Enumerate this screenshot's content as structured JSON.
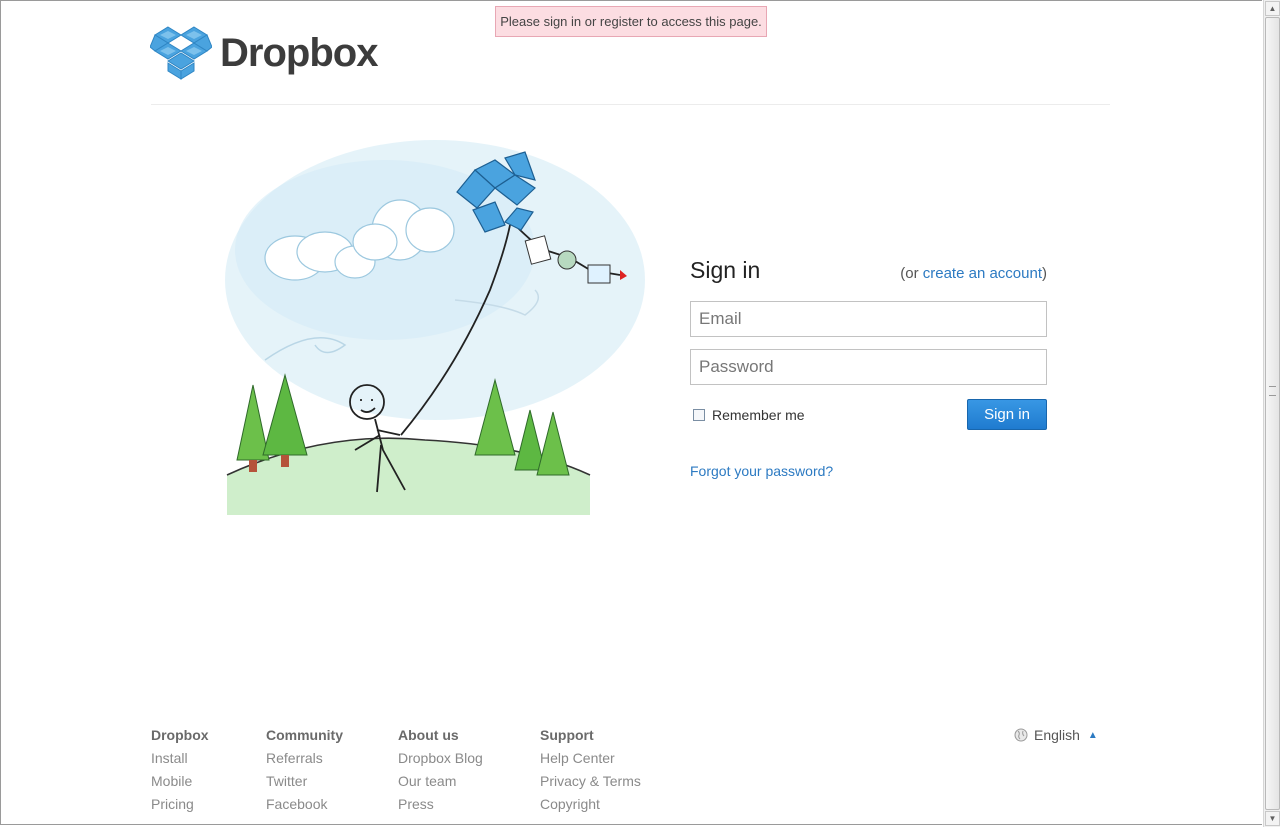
{
  "flash": {
    "message": "Please sign in or register to access this page."
  },
  "logo": {
    "text": "Dropbox"
  },
  "signin": {
    "title": "Sign in",
    "alt_prefix": "(or ",
    "alt_link": "create an account",
    "alt_suffix": ")",
    "email_placeholder": "Email",
    "password_placeholder": "Password",
    "remember_label": "Remember me",
    "remember_checked": false,
    "button_label": "Sign in",
    "forgot_link": "Forgot your password?"
  },
  "footer": {
    "columns": [
      {
        "head": "Dropbox",
        "items": [
          "Install",
          "Mobile",
          "Pricing"
        ]
      },
      {
        "head": "Community",
        "items": [
          "Referrals",
          "Twitter",
          "Facebook"
        ]
      },
      {
        "head": "About us",
        "items": [
          "Dropbox Blog",
          "Our team",
          "Press"
        ]
      },
      {
        "head": "Support",
        "items": [
          "Help Center",
          "Privacy & Terms",
          "Copyright"
        ]
      }
    ],
    "language": "English",
    "language_icon": "globe-icon",
    "language_caret_icon": "caret-up-icon"
  },
  "colors": {
    "link": "#2c7ac2",
    "button": "#2b8ad9",
    "flash_bg": "#fcdde2",
    "logo_blue": "#4aa3df"
  }
}
